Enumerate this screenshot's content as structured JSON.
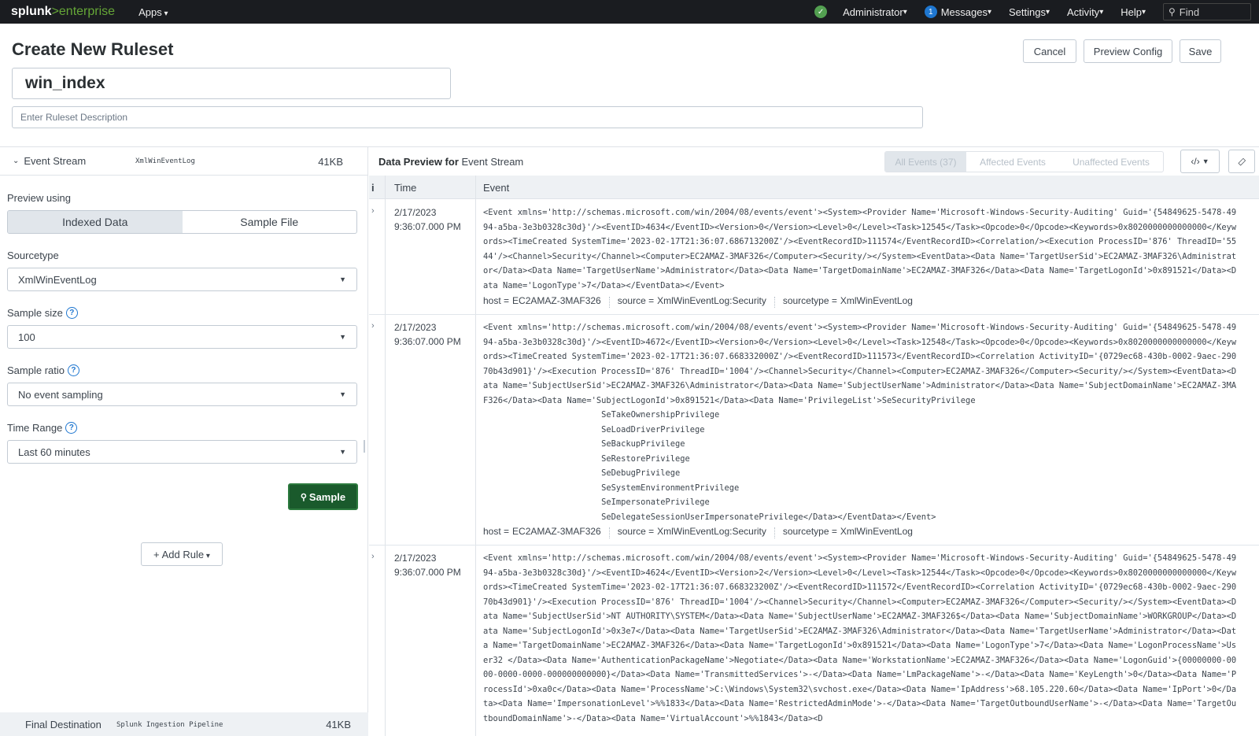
{
  "topbar": {
    "logo_main": "splunk",
    "logo_gt": ">",
    "logo_sub": "enterprise",
    "apps_label": "Apps",
    "user_label": "Administrator",
    "messages_count": "1",
    "messages_label": "Messages",
    "settings_label": "Settings",
    "activity_label": "Activity",
    "help_label": "Help",
    "find_label": "Find"
  },
  "page": {
    "title": "Create New Ruleset",
    "cancel_label": "Cancel",
    "preview_config_label": "Preview Config",
    "save_label": "Save",
    "ruleset_name": "win_index",
    "description_placeholder": "Enter Ruleset Description"
  },
  "left": {
    "stream_name": "Event Stream",
    "stream_source": "XmlWinEventLog",
    "stream_size": "41KB",
    "preview_using_label": "Preview using",
    "preview_options": [
      "Indexed Data",
      "Sample File"
    ],
    "sourcetype_label": "Sourcetype",
    "sourcetype_value": "XmlWinEventLog",
    "sample_size_label": "Sample size",
    "sample_size_value": "100",
    "sample_ratio_label": "Sample ratio",
    "sample_ratio_value": "No event sampling",
    "time_range_label": "Time Range",
    "time_range_value": "Last 60 minutes",
    "sample_button": "Sample",
    "add_rule_label": "Add Rule",
    "final_dest_label": "Final Destination",
    "final_dest_source": "Splunk Ingestion Pipeline",
    "final_dest_size": "41KB"
  },
  "preview": {
    "title_bold": "Data Preview for",
    "title_rest": "Event Stream",
    "filters": [
      "All Events (37)",
      "Affected Events",
      "Unaffected Events"
    ],
    "col_i": "i",
    "col_time": "Time",
    "col_event": "Event",
    "rows": [
      {
        "date": "2/17/2023",
        "time": "9:36:07.000 PM",
        "event": "<Event xmlns='http://schemas.microsoft.com/win/2004/08/events/event'><System><Provider Name='Microsoft-Windows-Security-Auditing' Guid='{54849625-5478-4994-a5ba-3e3b0328c30d}'/><EventID>4634</EventID><Version>0</Version><Level>0</Level><Task>12545</Task><Opcode>0</Opcode><Keywords>0x8020000000000000</Keywords><TimeCreated SystemTime='2023-02-17T21:36:07.686713200Z'/><EventRecordID>111574</EventRecordID><Correlation/><Execution ProcessID='876' ThreadID='5544'/><Channel>Security</Channel><Computer>EC2AMAZ-3MAF326</Computer><Security/></System><EventData><Data Name='TargetUserSid'>EC2AMAZ-3MAF326\\Administrator</Data><Data Name='TargetUserName'>Administrator</Data><Data Name='TargetDomainName'>EC2AMAZ-3MAF326</Data><Data Name='TargetLogonId'>0x891521</Data><Data Name='LogonType'>7</Data></EventData></Event>",
        "host": "EC2AMAZ-3MAF326",
        "source": "XmlWinEventLog:Security",
        "sourcetype": "XmlWinEventLog"
      },
      {
        "date": "2/17/2023",
        "time": "9:36:07.000 PM",
        "event": "<Event xmlns='http://schemas.microsoft.com/win/2004/08/events/event'><System><Provider Name='Microsoft-Windows-Security-Auditing' Guid='{54849625-5478-4994-a5ba-3e3b0328c30d}'/><EventID>4672</EventID><Version>0</Version><Level>0</Level><Task>12548</Task><Opcode>0</Opcode><Keywords>0x8020000000000000</Keywords><TimeCreated SystemTime='2023-02-17T21:36:07.668332000Z'/><EventRecordID>111573</EventRecordID><Correlation ActivityID='{0729ec68-430b-0002-9aec-29070b43d901}'/><Execution ProcessID='876' ThreadID='1004'/><Channel>Security</Channel><Computer>EC2AMAZ-3MAF326</Computer><Security/></System><EventData><Data Name='SubjectUserSid'>EC2AMAZ-3MAF326\\Administrator</Data><Data Name='SubjectUserName'>Administrator</Data><Data Name='SubjectDomainName'>EC2AMAZ-3MAF326</Data><Data Name='SubjectLogonId'>0x891521</Data><Data Name='PrivilegeList'>SeSecurityPrivilege\n\t\t\tSeTakeOwnershipPrivilege\n\t\t\tSeLoadDriverPrivilege\n\t\t\tSeBackupPrivilege\n\t\t\tSeRestorePrivilege\n\t\t\tSeDebugPrivilege\n\t\t\tSeSystemEnvironmentPrivilege\n\t\t\tSeImpersonatePrivilege\n\t\t\tSeDelegateSessionUserImpersonatePrivilege</Data></EventData></Event>",
        "host": "EC2AMAZ-3MAF326",
        "source": "XmlWinEventLog:Security",
        "sourcetype": "XmlWinEventLog"
      },
      {
        "date": "2/17/2023",
        "time": "9:36:07.000 PM",
        "event": "<Event xmlns='http://schemas.microsoft.com/win/2004/08/events/event'><System><Provider Name='Microsoft-Windows-Security-Auditing' Guid='{54849625-5478-4994-a5ba-3e3b0328c30d}'/><EventID>4624</EventID><Version>2</Version><Level>0</Level><Task>12544</Task><Opcode>0</Opcode><Keywords>0x8020000000000000</Keywords><TimeCreated SystemTime='2023-02-17T21:36:07.668323200Z'/><EventRecordID>111572</EventRecordID><Correlation ActivityID='{0729ec68-430b-0002-9aec-29070b43d901}'/><Execution ProcessID='876' ThreadID='1004'/><Channel>Security</Channel><Computer>EC2AMAZ-3MAF326</Computer><Security/></System><EventData><Data Name='SubjectUserSid'>NT AUTHORITY\\SYSTEM</Data><Data Name='SubjectUserName'>EC2AMAZ-3MAF326$</Data><Data Name='SubjectDomainName'>WORKGROUP</Data><Data Name='SubjectLogonId'>0x3e7</Data><Data Name='TargetUserSid'>EC2AMAZ-3MAF326\\Administrator</Data><Data Name='TargetUserName'>Administrator</Data><Data Name='TargetDomainName'>EC2AMAZ-3MAF326</Data><Data Name='TargetLogonId'>0x891521</Data><Data Name='LogonType'>7</Data><Data Name='LogonProcessName'>User32 </Data><Data Name='AuthenticationPackageName'>Negotiate</Data><Data Name='WorkstationName'>EC2AMAZ-3MAF326</Data><Data Name='LogonGuid'>{00000000-0000-0000-0000-000000000000}</Data><Data Name='TransmittedServices'>-</Data><Data Name='LmPackageName'>-</Data><Data Name='KeyLength'>0</Data><Data Name='ProcessId'>0xa0c</Data><Data Name='ProcessName'>C:\\Windows\\System32\\svchost.exe</Data><Data Name='IpAddress'>68.105.220.60</Data><Data Name='IpPort'>0</Data><Data Name='ImpersonationLevel'>%%1833</Data><Data Name='RestrictedAdminMode'>-</Data><Data Name='TargetOutboundUserName'>-</Data><Data Name='TargetOutboundDomainName'>-</Data><Data Name='VirtualAccount'>%%1843</Data><D"
      }
    ],
    "meta_keys": {
      "host": "host =",
      "source": "source =",
      "sourcetype": "sourcetype ="
    }
  },
  "colors": {
    "topbar_bg": "#1a1c20",
    "brand_green": "#65a637",
    "sample_button_bg": "#1a5a2c",
    "link_blue": "#1f77d0"
  }
}
